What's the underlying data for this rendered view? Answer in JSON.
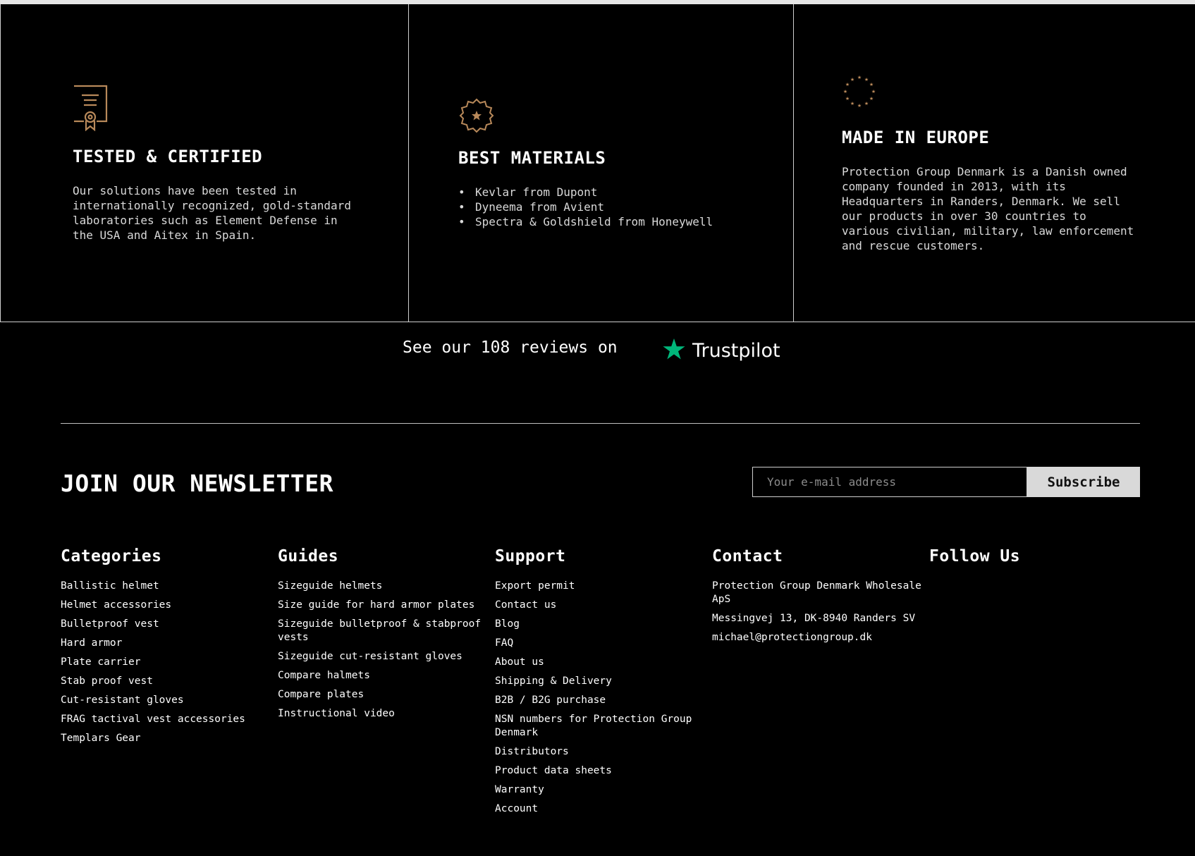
{
  "colors": {
    "background": "#000000",
    "accent_gold": "#b8895a",
    "trustpilot_green": "#00b67a",
    "button_bg": "#d9d9d9"
  },
  "features": [
    {
      "icon": "certificate-icon",
      "title": "TESTED & CERTIFIED",
      "text": "Our solutions have been tested in internationally recognized, gold-standard laboratories such as Element Defense in the USA and Aitex in Spain."
    },
    {
      "icon": "star-badge-icon",
      "title": "BEST MATERIALS",
      "items": [
        "Kevlar from Dupont",
        "Dyneema from Avient",
        "Spectra & Goldshield from Honeywell"
      ]
    },
    {
      "icon": "eu-stars-icon",
      "title": "MADE IN EUROPE",
      "text": "Protection Group Denmark is a Danish owned company founded in 2013, with its Headquarters in Randers, Denmark. We sell our products in over 30 countries to various civilian, military, law enforcement and rescue customers."
    }
  ],
  "trustpilot": {
    "text": "See our 108 reviews on",
    "brand": "Trustpilot",
    "icon": "trustpilot-star-icon"
  },
  "newsletter": {
    "title": "JOIN OUR NEWSLETTER",
    "placeholder": "Your e-mail address",
    "button": "Subscribe"
  },
  "footer": {
    "categories": {
      "title": "Categories",
      "items": [
        "Ballistic helmet",
        "Helmet accessories",
        "Bulletproof vest",
        "Hard armor",
        "Plate carrier",
        "Stab proof vest",
        "Cut-resistant gloves",
        "FRAG tactival vest accessories",
        "Templars Gear"
      ]
    },
    "guides": {
      "title": "Guides",
      "items": [
        "Sizeguide helmets",
        "Size guide for hard armor plates",
        "Sizeguide bulletproof & stabproof vests",
        "Sizeguide cut-resistant gloves",
        "Compare halmets",
        "Compare plates",
        "Instructional video"
      ]
    },
    "support": {
      "title": "Support",
      "items": [
        "Export permit",
        "Contact us",
        "Blog",
        "FAQ",
        "About us",
        "Shipping & Delivery",
        "B2B / B2G purchase",
        "NSN numbers for Protection Group Denmark",
        "Distributors",
        "Product data sheets",
        "Warranty",
        "Account"
      ]
    },
    "contact": {
      "title": "Contact",
      "items": [
        "Protection Group Denmark Wholesale ApS",
        "Messingvej 13, DK-8940 Randers SV",
        "michael@protectiongroup.dk"
      ]
    },
    "follow": {
      "title": "Follow Us"
    }
  }
}
